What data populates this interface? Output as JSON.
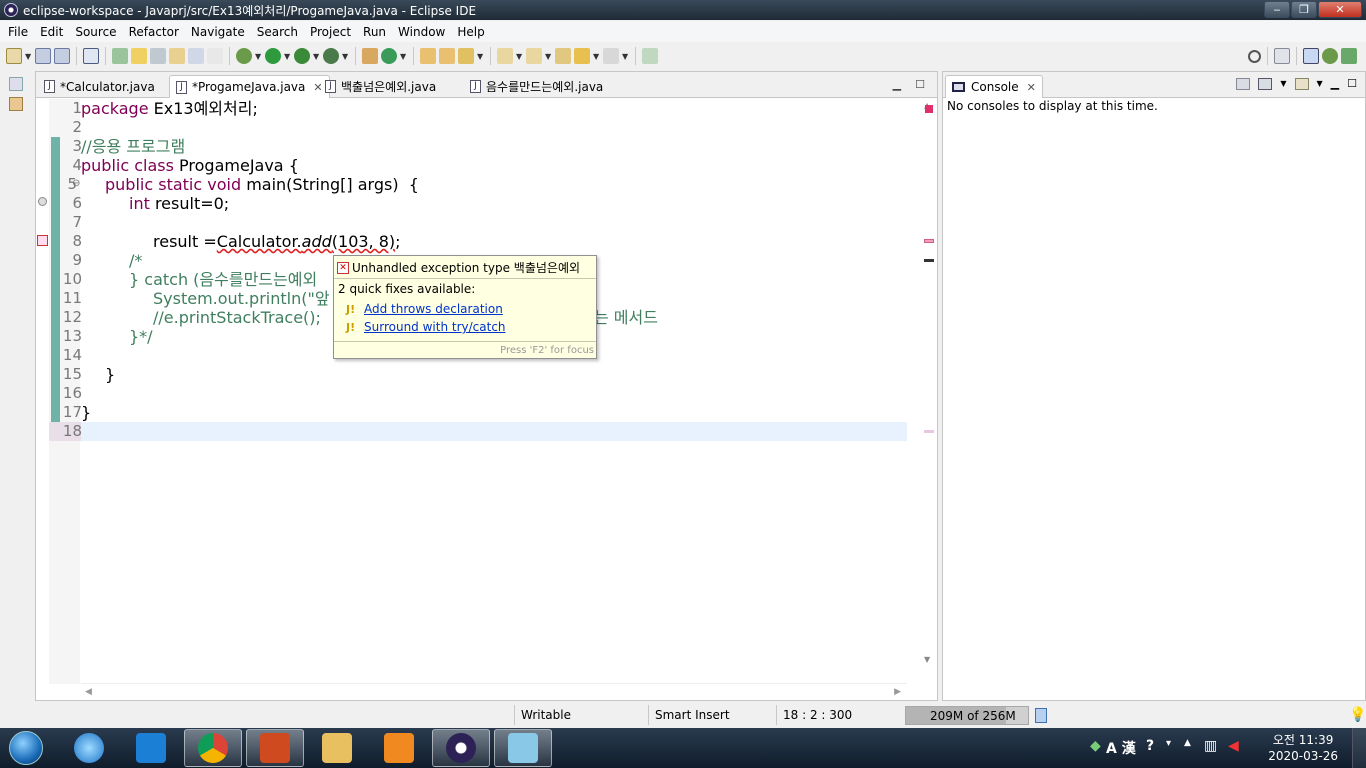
{
  "window": {
    "title": "eclipse-workspace - Javaprj/src/Ex13예외처리/ProgameJava.java - Eclipse IDE",
    "controls": [
      "‒",
      "❐",
      "✕"
    ]
  },
  "menu": [
    "File",
    "Edit",
    "Source",
    "Refactor",
    "Navigate",
    "Search",
    "Project",
    "Run",
    "Window",
    "Help"
  ],
  "editor": {
    "tabs": [
      {
        "label": "*Calculator.java",
        "active": false
      },
      {
        "label": "*ProgameJava.java",
        "active": true
      },
      {
        "label": "백출넘은예외.java",
        "active": false
      },
      {
        "label": "음수를만드는예외.java",
        "active": false
      }
    ],
    "tab_close": "✕",
    "line_numbers": [
      "1",
      "2",
      "3",
      "4",
      "5",
      "6",
      "7",
      "8",
      "9",
      "10",
      "11",
      "12",
      "13",
      "14",
      "15",
      "16",
      "17",
      "18"
    ],
    "fold_marker": "⊖",
    "code": {
      "l1_kw": "package",
      "l1_rest": " Ex13예외처리;",
      "l3": "//응용 프로그램",
      "l4_kw": "public class",
      "l4_rest": " ProgameJava {",
      "l5_kw": "public static void",
      "l5_rest": " main(String[] args)  {",
      "l6_kw": "int",
      "l6_rest": " result=0;",
      "l8_pre": "result =",
      "l8_err": "Calculator.",
      "l8_method": "add",
      "l8_args": "(103, 8)",
      "l8_end": ";",
      "l9": "/*",
      "l10": "} catch (음수를만드는예외",
      "l11": "System.out.println(\"앞",
      "l12": "//e.printStackTrace();",
      "l12_tail": "는 메서드",
      "l13": "}*/",
      "l15": "}",
      "l17": "}"
    }
  },
  "hover": {
    "error_title": "Unhandled exception type 백출넘은예외",
    "quick_fix_count": "2 quick fixes available:",
    "fixes": [
      "Add throws declaration",
      "Surround with try/catch"
    ],
    "focus_hint": "Press 'F2' for focus"
  },
  "console": {
    "tab_label": "Console",
    "message": "No consoles to display at this time."
  },
  "status": {
    "writable": "Writable",
    "insert_mode": "Smart Insert",
    "position": "18 : 2 : 300",
    "heap": "209M of 256M",
    "heap_fraction": 0.816
  },
  "taskbar": {
    "apps": [
      "internet-explorer",
      "visual-studio-code",
      "chrome",
      "powerpoint",
      "file-explorer",
      "media-player",
      "eclipse",
      "notepad"
    ],
    "ime_label": "A 漢",
    "time": "오전 11:39",
    "date": "2020-03-26"
  },
  "colors": {
    "keyword": "#7f0055",
    "comment": "#3f7f5f",
    "hover_bg": "#ffffe1",
    "change_bar": "#6fb3a8",
    "current_line": "#e8f2fe"
  }
}
